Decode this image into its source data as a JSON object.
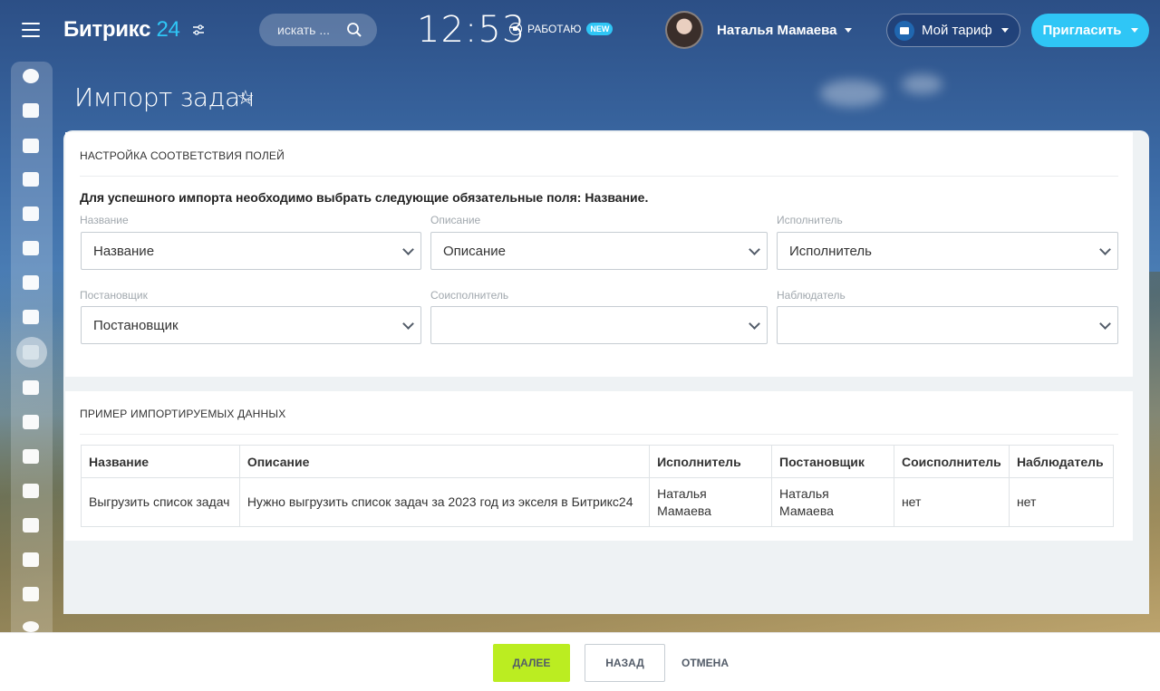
{
  "header": {
    "logo_text": "Битрикс",
    "logo_num": "24",
    "search_placeholder": "искать ...",
    "clock": "12:53",
    "work_status": "РАБОТАЮ",
    "new_badge": "NEW",
    "user_name": "Наталья Мамаева",
    "tariff_label": "Мой тариф",
    "invite_label": "Пригласить"
  },
  "page": {
    "title": "Импорт задач"
  },
  "mapping": {
    "section_title": "НАСТРОЙКА СООТВЕТСТВИЯ ПОЛЕЙ",
    "required_note": "Для успешного импорта необходимо выбрать следующие обязательные поля: Название.",
    "fields": [
      {
        "label": "Название",
        "value": "Название"
      },
      {
        "label": "Описание",
        "value": "Описание"
      },
      {
        "label": "Исполнитель",
        "value": "Исполнитель"
      },
      {
        "label": "Постановщик",
        "value": "Постановщик"
      },
      {
        "label": "Соисполнитель",
        "value": ""
      },
      {
        "label": "Наблюдатель",
        "value": ""
      }
    ]
  },
  "preview": {
    "section_title": "ПРИМЕР ИМПОРТИРУЕМЫХ ДАННЫХ",
    "columns": [
      "Название",
      "Описание",
      "Исполнитель",
      "Постановщик",
      "Соисполнитель",
      "Наблюдатель"
    ],
    "rows": [
      [
        "Выгрузить список задач",
        "Нужно выгрузить список задач за 2023 год из экселя в Битрикс24",
        "Наталья Мамаева",
        "Наталья Мамаева",
        "нет",
        "нет"
      ]
    ]
  },
  "footer": {
    "next_label": "ДАЛЕЕ",
    "back_label": "НАЗАД",
    "cancel_label": "ОТМЕНА"
  },
  "colors": {
    "accent": "#2fc6f6",
    "next_button": "#bbed21"
  }
}
